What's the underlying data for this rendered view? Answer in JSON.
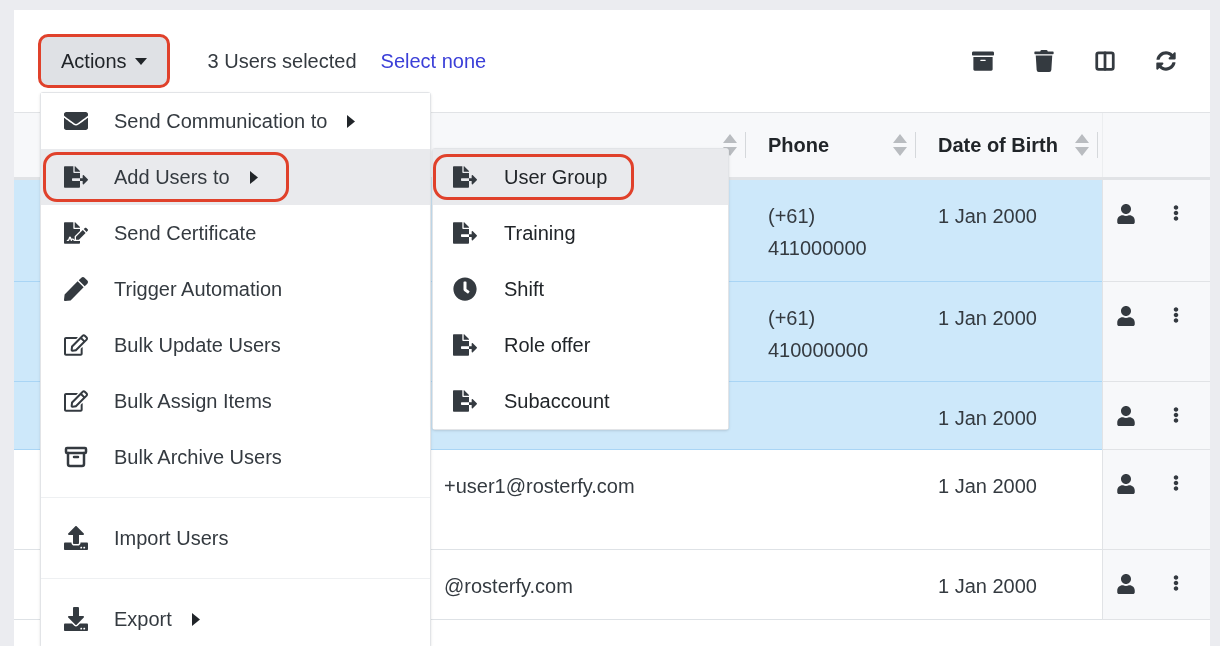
{
  "toolbar": {
    "actions_button": {
      "label": "Actions",
      "highlighted": true
    },
    "selection_count": "3 Users selected",
    "select_none_link": "Select none"
  },
  "table": {
    "columns": [
      {
        "sortable": true
      },
      {
        "label": "Phone",
        "sortable": true
      },
      {
        "label": "Date of Birth",
        "sortable": true
      }
    ],
    "rows": [
      {
        "selected": true,
        "phone": "(+61) 411000000",
        "dob": "1 Jan 2000"
      },
      {
        "selected": true,
        "phone": "(+61) 410000000",
        "dob": "1 Jan 2000"
      },
      {
        "selected": true,
        "dob": "1 Jan 2000"
      },
      {
        "selected": false,
        "email": "+user1@rosterfy.com",
        "dob": "1 Jan 2000"
      },
      {
        "selected": false,
        "email": "@rosterfy.com",
        "dob": "1 Jan 2000"
      }
    ]
  },
  "actions_menu": {
    "items": [
      {
        "kind": "item",
        "label": "Send Communication to",
        "has_submenu": true,
        "selected": false,
        "highlighted": false
      },
      {
        "kind": "item",
        "label": "Add Users to",
        "has_submenu": true,
        "selected": true,
        "highlighted": true
      },
      {
        "kind": "item",
        "label": "Send Certificate",
        "has_submenu": false,
        "selected": false,
        "highlighted": false
      },
      {
        "kind": "item",
        "label": "Trigger Automation",
        "has_submenu": false,
        "selected": false,
        "highlighted": false
      },
      {
        "kind": "item",
        "label": "Bulk Update Users",
        "has_submenu": false,
        "selected": false,
        "highlighted": false
      },
      {
        "kind": "item",
        "label": "Bulk Assign Items",
        "has_submenu": false,
        "selected": false,
        "highlighted": false
      },
      {
        "kind": "item",
        "label": "Bulk Archive Users",
        "has_submenu": false,
        "selected": false,
        "highlighted": false
      },
      {
        "kind": "divider"
      },
      {
        "kind": "item",
        "label": "Import Users",
        "has_submenu": false,
        "selected": false,
        "highlighted": false
      },
      {
        "kind": "divider"
      },
      {
        "kind": "item",
        "label": "Export",
        "has_submenu": true,
        "selected": false,
        "highlighted": false
      }
    ]
  },
  "submenu": {
    "items": [
      {
        "label": "User Group",
        "selected": true,
        "highlighted": true
      },
      {
        "label": "Training",
        "selected": false,
        "highlighted": false
      },
      {
        "label": "Shift",
        "selected": false,
        "highlighted": false
      },
      {
        "label": "Role offer",
        "selected": false,
        "highlighted": false
      },
      {
        "label": "Subaccount",
        "selected": false,
        "highlighted": false
      }
    ]
  }
}
